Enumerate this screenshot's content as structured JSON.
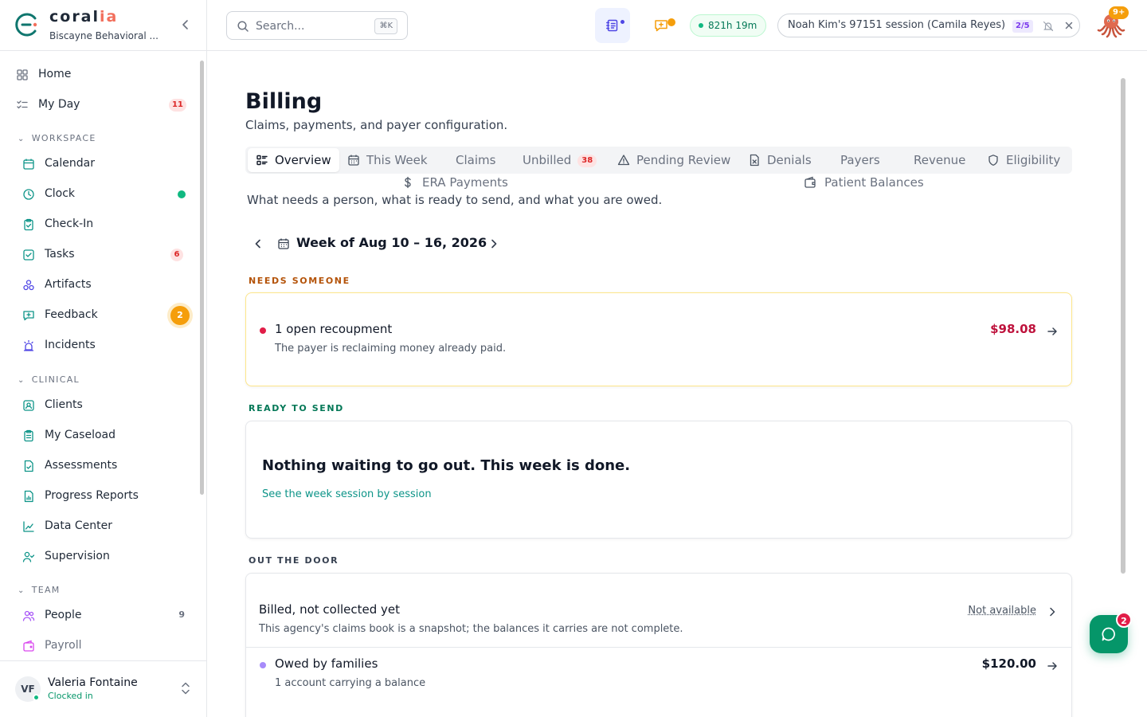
{
  "brand": {
    "name_part1": "coral",
    "name_part2": "ia",
    "org": "Biscayne Behavioral ...",
    "accent_color": "#f26f5c"
  },
  "sidebar": {
    "primary": [
      {
        "label": "Home",
        "icon": "grid-icon"
      },
      {
        "label": "My Day",
        "icon": "checklist-icon",
        "badge": "11"
      }
    ],
    "sections": {
      "workspace": "WORKSPACE",
      "clinical": "CLINICAL",
      "team": "TEAM"
    },
    "workspace_items": [
      {
        "label": "Calendar",
        "icon": "calendar-icon"
      },
      {
        "label": "Clock",
        "icon": "clock-icon",
        "status": "active"
      },
      {
        "label": "Check-In",
        "icon": "clipboard-icon"
      },
      {
        "label": "Tasks",
        "icon": "checkbox-icon",
        "badge": "6"
      },
      {
        "label": "Artifacts",
        "icon": "shapes-icon"
      },
      {
        "label": "Feedback",
        "icon": "message-plus-icon",
        "badge": "2"
      },
      {
        "label": "Incidents",
        "icon": "siren-icon"
      }
    ],
    "clinical_items": [
      {
        "label": "Clients",
        "icon": "contact-icon"
      },
      {
        "label": "My Caseload",
        "icon": "clipboard-list-icon"
      },
      {
        "label": "Assessments",
        "icon": "file-check-icon"
      },
      {
        "label": "Progress Reports",
        "icon": "file-chart-icon"
      },
      {
        "label": "Data Center",
        "icon": "line-chart-icon"
      },
      {
        "label": "Supervision",
        "icon": "user-check-icon"
      }
    ],
    "team_items": [
      {
        "label": "People",
        "icon": "users-icon",
        "badge": "9"
      },
      {
        "label": "Payroll",
        "icon": "wallet-icon"
      }
    ]
  },
  "user": {
    "initials": "VF",
    "name": "Valeria Fontaine",
    "status": "Clocked in"
  },
  "topbar": {
    "search_placeholder": "Search...",
    "search_shortcut": "⌘K",
    "timer": "821h 19m",
    "session": "Noah Kim's 97151 session (Camila Reyes)",
    "session_progress": "2/5",
    "avatar_badge": "9+"
  },
  "page": {
    "title": "Billing",
    "subtitle": "Claims, payments, and payer configuration.",
    "tabs": [
      {
        "label": "Overview",
        "icon": "layout-list-icon",
        "active": true
      },
      {
        "label": "This Week",
        "icon": "calendar-icon"
      },
      {
        "label": "Claims"
      },
      {
        "label": "Unbilled",
        "badge": "38"
      },
      {
        "label": "Pending Review",
        "icon": "alert-triangle-icon"
      },
      {
        "label": "Denials",
        "icon": "file-x-icon"
      },
      {
        "label": "Payers"
      },
      {
        "label": "Revenue"
      },
      {
        "label": "Eligibility",
        "icon": "shield-icon"
      },
      {
        "label": "ERA Payments",
        "icon": "dollar-icon"
      },
      {
        "label": "Patient Balances",
        "icon": "wallet-icon"
      }
    ],
    "overview_desc": "What needs a person, what is ready to send, and what you are owed.",
    "week_label": "Week of Aug 10 – 16, 2026"
  },
  "needs_someone": {
    "label": "NEEDS SOMEONE",
    "label_color": "#b45309",
    "item_title": "1 open recoupment",
    "item_desc": "The payer is reclaiming money already paid.",
    "item_amount": "$98.08",
    "amount_color": "#be123c"
  },
  "ready_to_send": {
    "label": "READY TO SEND",
    "label_color": "#047857",
    "empty_title": "Nothing waiting to go out. This week is done.",
    "link": "See the week session by session"
  },
  "out_the_door": {
    "label": "OUT THE DOOR",
    "rows": [
      {
        "title": "Billed, not collected yet",
        "desc": "This agency's claims book is a snapshot; the balances it carries are not complete.",
        "value": "Not available"
      },
      {
        "title": "Owed by families",
        "desc": "1 account carrying a balance",
        "value": "$120.00"
      }
    ]
  },
  "chat": {
    "badge": "2"
  }
}
